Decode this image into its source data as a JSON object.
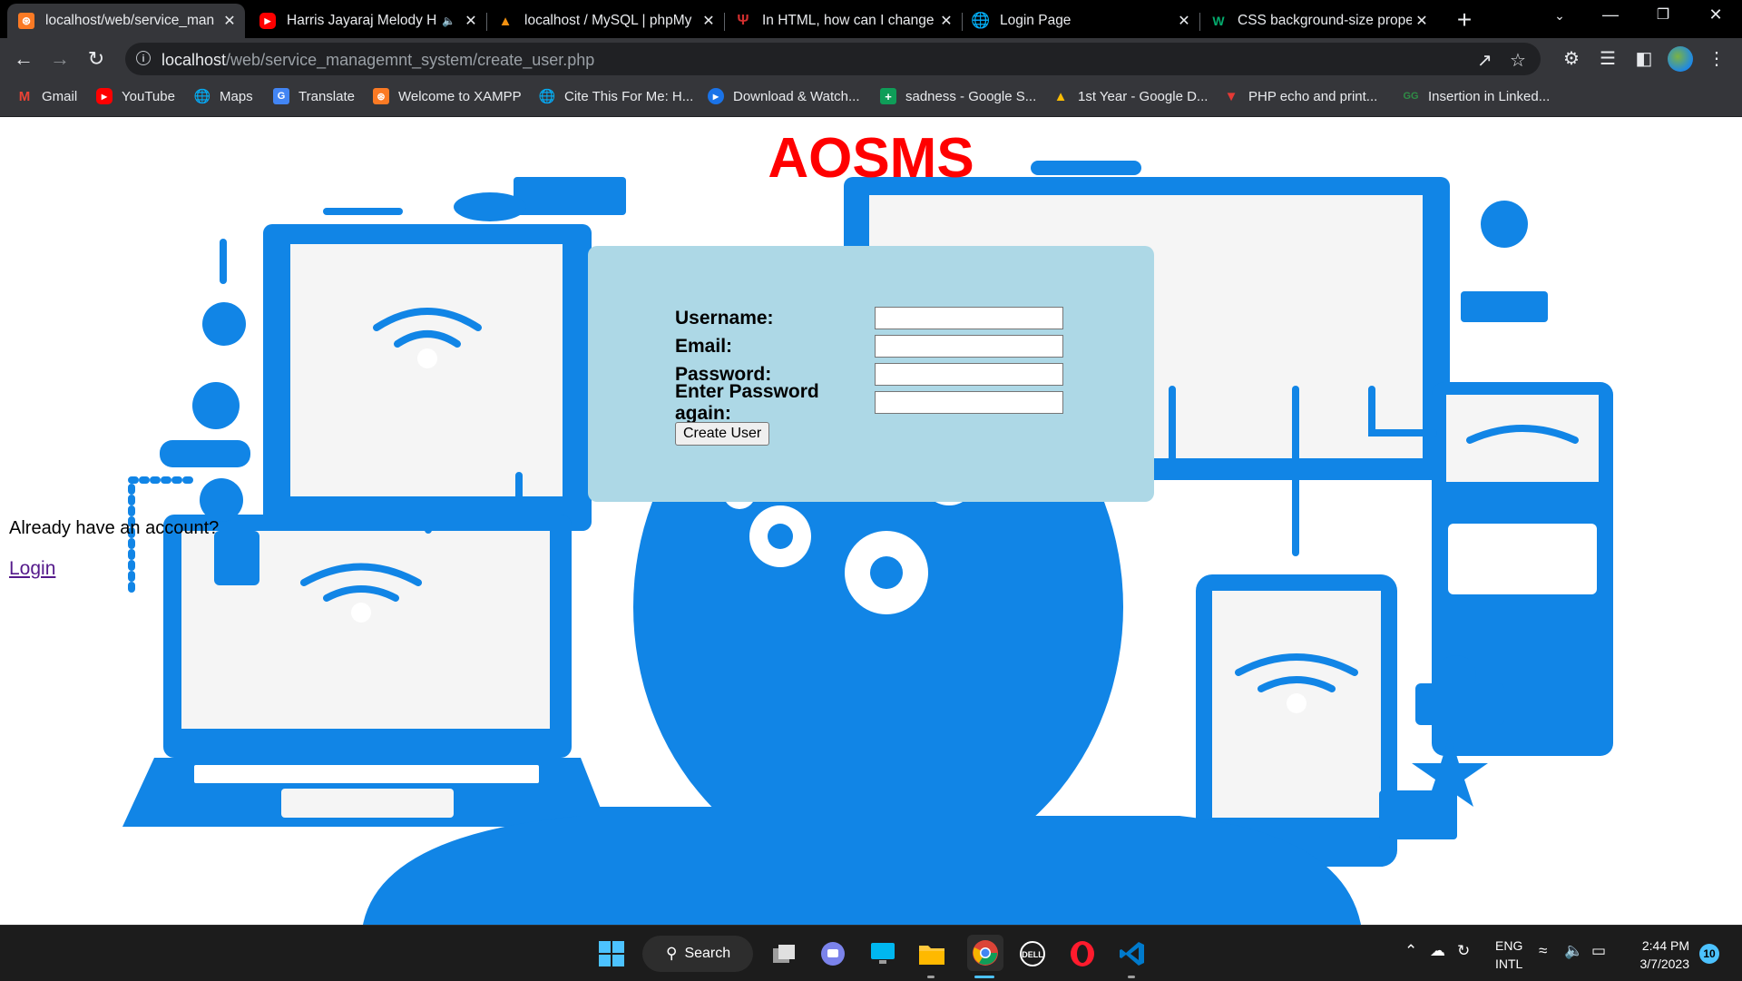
{
  "tabs": [
    {
      "title": "localhost/web/service_man",
      "favicon": "xampp-icon",
      "active": true
    },
    {
      "title": "Harris Jayaraj Melody H",
      "favicon": "youtube-icon",
      "audio": true
    },
    {
      "title": "localhost / MySQL | phpMy",
      "favicon": "phpmyadmin-icon"
    },
    {
      "title": "In HTML, how can I change",
      "favicon": "site-icon"
    },
    {
      "title": "Login Page",
      "favicon": "globe-icon"
    },
    {
      "title": "CSS background-size prope",
      "favicon": "w3schools-icon"
    }
  ],
  "address_bar": {
    "host": "localhost",
    "path": "/web/service_managemnt_system/create_user.php"
  },
  "bookmarks": [
    {
      "label": "Gmail",
      "icon": "gmail-icon"
    },
    {
      "label": "YouTube",
      "icon": "youtube-icon"
    },
    {
      "label": "Maps",
      "icon": "globe-icon"
    },
    {
      "label": "Translate",
      "icon": "translate-icon"
    },
    {
      "label": "Welcome to XAMPP",
      "icon": "xampp-icon"
    },
    {
      "label": "Cite This For Me: H...",
      "icon": "globe-icon"
    },
    {
      "label": "Download & Watch...",
      "icon": "play-icon"
    },
    {
      "label": "sadness - Google S...",
      "icon": "sheets-icon"
    },
    {
      "label": "1st Year - Google D...",
      "icon": "drive-icon"
    },
    {
      "label": "PHP echo and print...",
      "icon": "v-icon"
    },
    {
      "label": "Insertion in Linked...",
      "icon": "gfg-icon"
    }
  ],
  "page": {
    "title": "AOSMS",
    "form": {
      "username_label": "Username:",
      "email_label": "Email:",
      "password_label": "Password:",
      "password_again_label": "Enter Password again:",
      "username_value": "",
      "email_value": "",
      "password_value": "",
      "password_again_value": "",
      "submit_label": "Create User"
    },
    "already_text": "Already have an account?",
    "login_link": "Login"
  },
  "taskbar": {
    "search_label": "Search",
    "lang_line1": "ENG",
    "lang_line2": "INTL",
    "time": "2:44 PM",
    "date": "3/7/2023",
    "notifications": "10"
  },
  "colors": {
    "title_red": "#ff0000",
    "form_bg": "#add8e6",
    "art_blue": "#1185e6",
    "link_visited": "#551a8b"
  }
}
